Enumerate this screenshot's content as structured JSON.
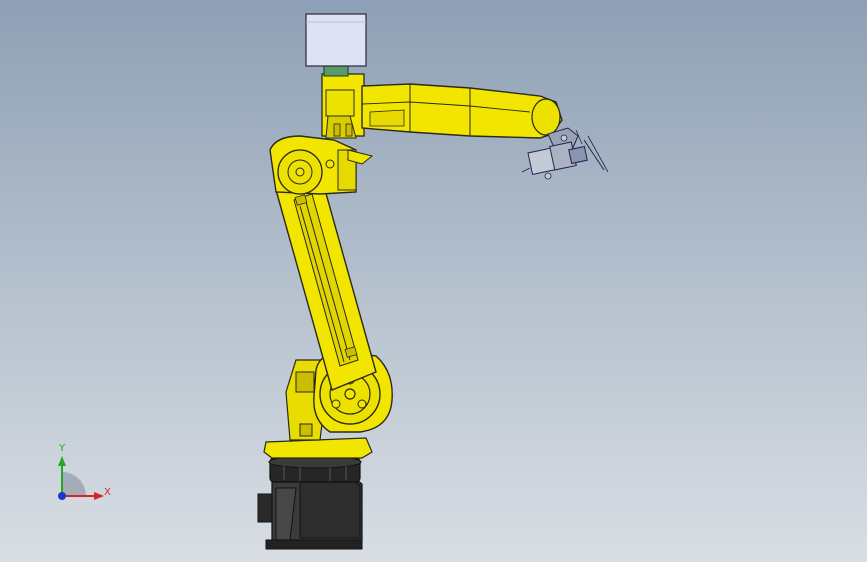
{
  "viewport": {
    "background_top": "#8ea0b5",
    "background_bottom": "#d9dee4"
  },
  "model": {
    "body_color": "#f2e500",
    "shade_color": "#c9bf00",
    "edge_color": "#2a2a1a",
    "base_color": "#3c3c3c",
    "base_dark": "#1f1f1f",
    "motor_box_color": "#dfe1f4",
    "motor_connector_color": "#5a9a6a"
  },
  "triad": {
    "y_label": "Y",
    "x_label": "X",
    "y_color": "#22aa22",
    "x_color": "#dd2222",
    "z_color": "#2233cc"
  }
}
